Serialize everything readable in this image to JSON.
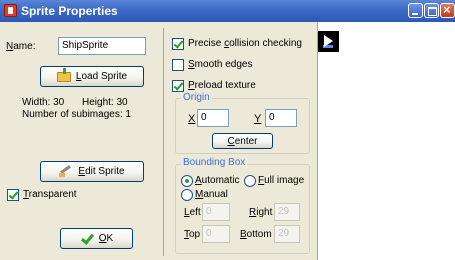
{
  "window": {
    "title": "Sprite Properties"
  },
  "left": {
    "name_label": "Name:",
    "name_value": "ShipSprite",
    "load_button": "Load Sprite",
    "width_text": "Width: 30",
    "height_text": "Height: 30",
    "subimages_text": "Number of subimages: 1",
    "edit_button": "Edit Sprite",
    "transparent_label": "Transparent",
    "transparent_checked": true,
    "ok_button": "OK"
  },
  "options": {
    "precise_label": "Precise collision checking",
    "precise_checked": true,
    "smooth_label": "Smooth edges",
    "smooth_checked": false,
    "preload_label": "Preload texture",
    "preload_checked": true
  },
  "origin": {
    "title": "Origin",
    "x_label": "X",
    "x_value": "0",
    "y_label": "Y",
    "y_value": "0",
    "center_button": "Center"
  },
  "bbox": {
    "title": "Bounding Box",
    "automatic_label": "Automatic",
    "full_image_label": "Full image",
    "manual_label": "Manual",
    "selected": "Automatic",
    "left_label": "Left",
    "left_value": "0",
    "right_label": "Right",
    "right_value": "29",
    "top_label": "Top",
    "top_value": "0",
    "bottom_label": "Bottom",
    "bottom_value": "29"
  },
  "colors": {
    "titlebar": "#3f6cc7",
    "dialog_bg": "#ece9d8",
    "group_title": "#3f6fd8",
    "check_mark": "#21a121"
  }
}
